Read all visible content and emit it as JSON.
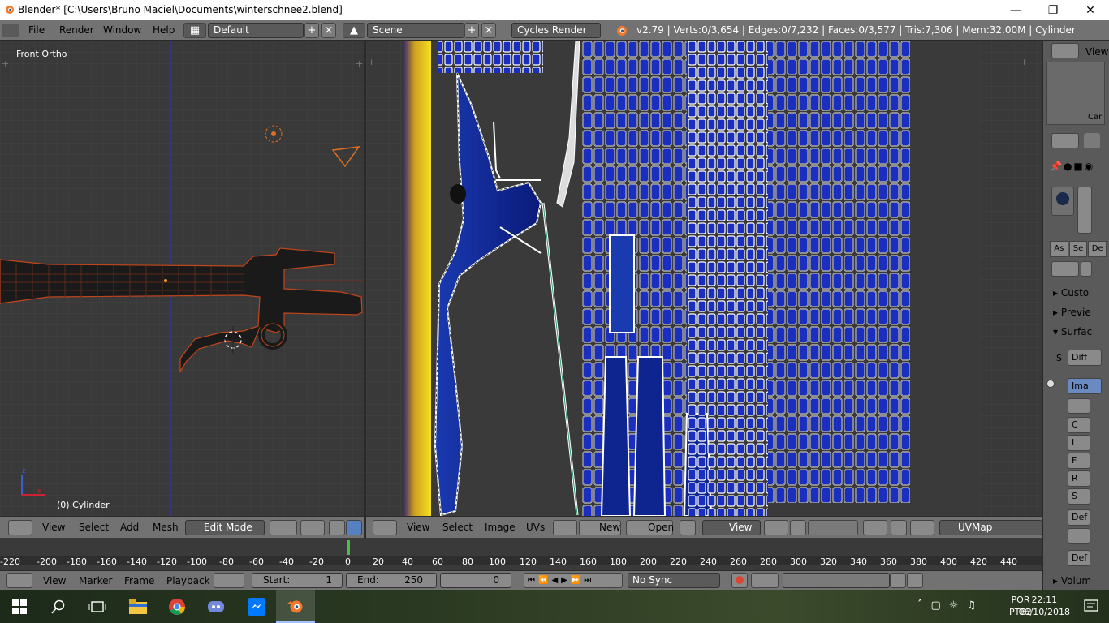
{
  "titlebar": {
    "title": "Blender* [C:\\Users\\Bruno Maciel\\Documents\\winterschnee2.blend]"
  },
  "infobar": {
    "menus": [
      "File",
      "Render",
      "Window",
      "Help"
    ],
    "layout": "Default",
    "scene": "Scene",
    "engine": "Cycles Render",
    "stats": "v2.79 | Verts:0/3,654 | Edges:0/7,232 | Faces:0/3,577 | Tris:7,306 | Mem:32.00M | Cylinder"
  },
  "viewport3d": {
    "view_label": "Front Ortho",
    "object_label": "(0) Cylinder",
    "header": {
      "menus": [
        "View",
        "Select",
        "Add",
        "Mesh"
      ],
      "mode": "Edit Mode"
    }
  },
  "uv_editor": {
    "header": {
      "menus": [
        "View",
        "Select",
        "Image",
        "UVs"
      ],
      "new_label": "New",
      "open_label": "Open",
      "view_label": "View",
      "uvmap": "UVMap"
    }
  },
  "timeline": {
    "ticks": [
      "-220",
      "-200",
      "-180",
      "-160",
      "-140",
      "-120",
      "-100",
      "-80",
      "-60",
      "-40",
      "-20",
      "0",
      "20",
      "40",
      "60",
      "80",
      "100",
      "120",
      "140",
      "160",
      "180",
      "200",
      "220",
      "240",
      "260",
      "280",
      "300",
      "320",
      "340",
      "360",
      "380",
      "400",
      "420",
      "440"
    ],
    "header": {
      "menus": [
        "View",
        "Marker",
        "Frame",
        "Playback"
      ],
      "start_label": "Start:",
      "start_value": "1",
      "end_label": "End:",
      "end_value": "250",
      "current_frame": "0",
      "sync": "No Sync"
    }
  },
  "properties": {
    "view_label": "View",
    "cam_label": "Car",
    "tabs": [
      "As",
      "Se",
      "De"
    ],
    "panels": [
      "Custo",
      "Previe",
      "Surfac",
      "Volum"
    ],
    "surface_s": "S",
    "surface_diff": "Diff",
    "image_btn": "Ima",
    "sockets": [
      "C",
      "L",
      "F",
      "R",
      "S"
    ],
    "def1": "Def",
    "def2": "Def"
  },
  "taskbar": {
    "lang_top": "POR",
    "lang_bottom": "PTB2",
    "time": "22:11",
    "date": "06/10/2018"
  }
}
